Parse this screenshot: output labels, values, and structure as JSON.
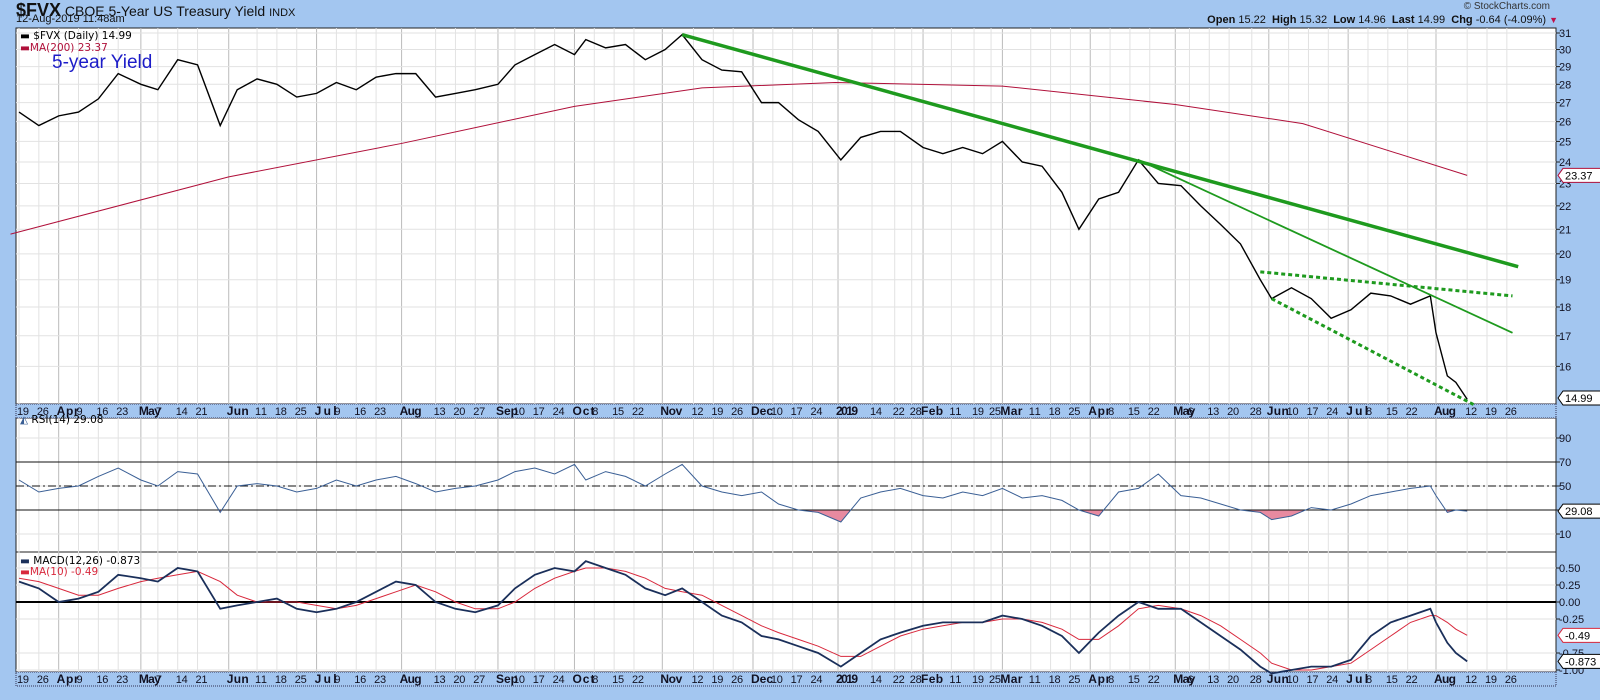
{
  "header": {
    "symbol": "$FVX",
    "name": "CBOE 5-Year US Treasury Yield",
    "exchange": "INDX",
    "timestamp": "12-Aug-2019 11:48am",
    "copyright": "© StockCharts.com",
    "open_label": "Open",
    "open": "15.22",
    "high_label": "High",
    "high": "15.32",
    "low_label": "Low",
    "low": "14.96",
    "last_label": "Last",
    "last": "14.99",
    "chg_label": "Chg",
    "chg": "-0.64 (-4.09%)",
    "chg_arrow": "▼"
  },
  "colors": {
    "price": "#000000",
    "ma200": "#b0103a",
    "trend": "#1e9a1e",
    "rsi": "#3a5f95",
    "rsi_over": "#6a9bd8",
    "rsi_under": "#e88aa0",
    "macd": "#1a2f5a",
    "signal": "#d8283c"
  },
  "chart_data": [
    {
      "type": "line",
      "title": "$FVX (Daily) 14.99",
      "ma_label": "MA(200) 23.37",
      "annotation": "5-year Yield",
      "scale": "log",
      "ylim": [
        15,
        31
      ],
      "yticks": [
        16,
        17,
        18,
        19,
        20,
        21,
        22,
        23,
        24,
        25,
        26,
        27,
        28,
        29,
        30,
        31
      ],
      "dates": [
        "2018-03-19",
        "2018-03-26",
        "2018-04-02",
        "2018-04-09",
        "2018-04-16",
        "2018-04-23",
        "2018-05-01",
        "2018-05-07",
        "2018-05-14",
        "2018-05-21",
        "2018-05-29",
        "2018-06-04",
        "2018-06-11",
        "2018-06-18",
        "2018-06-25",
        "2018-07-02",
        "2018-07-09",
        "2018-07-16",
        "2018-07-23",
        "2018-07-30",
        "2018-08-06",
        "2018-08-13",
        "2018-08-20",
        "2018-08-27",
        "2018-09-04",
        "2018-09-10",
        "2018-09-17",
        "2018-09-24",
        "2018-10-01",
        "2018-10-05",
        "2018-10-12",
        "2018-10-19",
        "2018-10-26",
        "2018-11-02",
        "2018-11-08",
        "2018-11-15",
        "2018-11-22",
        "2018-11-29",
        "2018-12-06",
        "2018-12-12",
        "2018-12-19",
        "2018-12-26",
        "2019-01-03",
        "2019-01-10",
        "2019-01-17",
        "2019-01-24",
        "2019-02-01",
        "2019-02-08",
        "2019-02-15",
        "2019-02-22",
        "2019-03-01",
        "2019-03-08",
        "2019-03-15",
        "2019-03-22",
        "2019-03-28",
        "2019-04-04",
        "2019-04-11",
        "2019-04-18",
        "2019-04-25",
        "2019-05-03",
        "2019-05-10",
        "2019-05-17",
        "2019-05-24",
        "2019-05-31",
        "2019-06-04",
        "2019-06-11",
        "2019-06-18",
        "2019-06-25",
        "2019-07-02",
        "2019-07-09",
        "2019-07-16",
        "2019-07-23",
        "2019-07-30",
        "2019-08-01",
        "2019-08-05",
        "2019-08-08",
        "2019-08-12"
      ],
      "values": [
        26.5,
        25.8,
        26.3,
        26.5,
        27.2,
        28.6,
        28.0,
        27.7,
        29.4,
        29.1,
        25.8,
        27.7,
        28.3,
        28.0,
        27.3,
        27.5,
        28.1,
        27.7,
        28.4,
        28.6,
        28.6,
        27.3,
        27.5,
        27.7,
        28.0,
        29.1,
        29.7,
        30.3,
        29.7,
        30.6,
        30.1,
        30.3,
        29.4,
        30.0,
        30.9,
        29.4,
        28.8,
        28.7,
        27.0,
        27.0,
        26.1,
        25.5,
        24.1,
        25.2,
        25.5,
        25.5,
        24.7,
        24.4,
        24.7,
        24.4,
        25.0,
        24.0,
        23.8,
        22.6,
        21.0,
        22.3,
        22.6,
        24.1,
        23.0,
        22.9,
        22.0,
        21.2,
        20.4,
        19.0,
        18.3,
        18.7,
        18.3,
        17.6,
        17.9,
        18.5,
        18.4,
        18.1,
        18.4,
        17.1,
        15.7,
        15.5,
        14.99
      ],
      "ma200": [
        [
          "2018-03-16",
          20.8
        ],
        [
          "2018-06-01",
          23.3
        ],
        [
          "2018-08-01",
          24.9
        ],
        [
          "2018-10-01",
          26.8
        ],
        [
          "2018-11-15",
          27.8
        ],
        [
          "2019-01-01",
          28.1
        ],
        [
          "2019-03-01",
          27.9
        ],
        [
          "2019-05-01",
          26.9
        ],
        [
          "2019-06-15",
          25.9
        ],
        [
          "2019-08-12",
          23.37
        ]
      ],
      "last_tag": "14.99",
      "ma_tag": "23.37",
      "trendlines": [
        {
          "style": "thick",
          "from": [
            "2018-11-08",
            30.9
          ],
          "to": [
            "2019-08-30",
            19.5
          ]
        },
        {
          "style": "thin",
          "from": [
            "2019-04-18",
            24.1
          ],
          "to": [
            "2019-08-28",
            17.1
          ]
        },
        {
          "style": "dotted",
          "from": [
            "2019-05-31",
            19.3
          ],
          "to": [
            "2019-08-28",
            18.4
          ]
        },
        {
          "style": "dotted",
          "from": [
            "2019-06-04",
            18.3
          ],
          "to": [
            "2019-08-15",
            14.8
          ]
        }
      ]
    },
    {
      "type": "line",
      "title": "RSI(14) 29.08",
      "ylim": [
        0,
        100
      ],
      "yticks": [
        10,
        30,
        50,
        70,
        90
      ],
      "levels": [
        70,
        50,
        30
      ],
      "last_tag": "29.08",
      "values": [
        55,
        45,
        48,
        50,
        58,
        65,
        55,
        50,
        62,
        60,
        28,
        50,
        52,
        50,
        45,
        48,
        55,
        50,
        55,
        58,
        52,
        45,
        48,
        50,
        55,
        62,
        65,
        60,
        68,
        55,
        62,
        58,
        50,
        60,
        68,
        50,
        45,
        42,
        45,
        35,
        30,
        28,
        20,
        40,
        45,
        48,
        42,
        40,
        45,
        42,
        48,
        40,
        42,
        38,
        30,
        25,
        45,
        48,
        60,
        42,
        40,
        35,
        30,
        28,
        22,
        25,
        32,
        30,
        35,
        42,
        45,
        48,
        50,
        42,
        28,
        30,
        29.08
      ]
    },
    {
      "type": "line",
      "title": "MACD(12,26) -0.873",
      "signal_title": "MA(10) -0.49",
      "yticks": [
        0.5,
        0.25,
        0.0,
        -0.25,
        -0.75,
        -1.0
      ],
      "ytick_labels": [
        "0.50",
        "0.25",
        "0.00",
        "-0.25",
        "-0.75",
        "-1.00"
      ],
      "macd_tag": "-0.873",
      "signal_tag": "-0.49",
      "macd": [
        0.3,
        0.2,
        0.0,
        0.05,
        0.15,
        0.4,
        0.35,
        0.3,
        0.5,
        0.45,
        -0.1,
        -0.05,
        0.0,
        0.05,
        -0.1,
        -0.15,
        -0.1,
        0.0,
        0.15,
        0.3,
        0.25,
        0.0,
        -0.1,
        -0.15,
        -0.05,
        0.2,
        0.4,
        0.5,
        0.45,
        0.6,
        0.5,
        0.4,
        0.2,
        0.1,
        0.2,
        0.0,
        -0.2,
        -0.3,
        -0.5,
        -0.55,
        -0.65,
        -0.75,
        -0.95,
        -0.75,
        -0.55,
        -0.45,
        -0.35,
        -0.3,
        -0.3,
        -0.3,
        -0.2,
        -0.25,
        -0.35,
        -0.5,
        -0.75,
        -0.45,
        -0.2,
        0.0,
        -0.1,
        -0.1,
        -0.3,
        -0.5,
        -0.7,
        -0.95,
        -1.05,
        -1.0,
        -0.95,
        -0.95,
        -0.85,
        -0.5,
        -0.3,
        -0.2,
        -0.1,
        -0.3,
        -0.6,
        -0.75,
        -0.873
      ],
      "signal": [
        0.35,
        0.3,
        0.2,
        0.1,
        0.1,
        0.2,
        0.3,
        0.35,
        0.4,
        0.45,
        0.3,
        0.1,
        0.0,
        0.0,
        0.0,
        -0.05,
        -0.1,
        -0.05,
        0.05,
        0.15,
        0.25,
        0.15,
        0.0,
        -0.1,
        -0.1,
        0.0,
        0.2,
        0.35,
        0.45,
        0.5,
        0.5,
        0.45,
        0.35,
        0.2,
        0.15,
        0.1,
        -0.05,
        -0.2,
        -0.35,
        -0.45,
        -0.55,
        -0.65,
        -0.8,
        -0.8,
        -0.65,
        -0.5,
        -0.4,
        -0.35,
        -0.3,
        -0.3,
        -0.25,
        -0.25,
        -0.3,
        -0.4,
        -0.55,
        -0.55,
        -0.35,
        -0.1,
        -0.05,
        -0.1,
        -0.2,
        -0.35,
        -0.55,
        -0.75,
        -0.9,
        -1.0,
        -1.0,
        -0.95,
        -0.9,
        -0.7,
        -0.5,
        -0.3,
        -0.2,
        -0.2,
        -0.3,
        -0.4,
        -0.49
      ]
    }
  ],
  "xaxis": [
    [
      "19",
      "2018-03-19",
      0
    ],
    [
      "26",
      "2018-03-26",
      0
    ],
    [
      "Apr",
      "2018-04-02",
      1
    ],
    [
      "9",
      "2018-04-09",
      0
    ],
    [
      "16",
      "2018-04-16",
      0
    ],
    [
      "23",
      "2018-04-23",
      0
    ],
    [
      "May",
      "2018-05-01",
      1
    ],
    [
      "7",
      "2018-05-07",
      0
    ],
    [
      "14",
      "2018-05-14",
      0
    ],
    [
      "21",
      "2018-05-21",
      0
    ],
    [
      "Jun",
      "2018-06-01",
      1
    ],
    [
      "11",
      "2018-06-11",
      0
    ],
    [
      "18",
      "2018-06-18",
      0
    ],
    [
      "25",
      "2018-06-25",
      0
    ],
    [
      "Jul",
      "2018-07-02",
      1
    ],
    [
      "9",
      "2018-07-09",
      0
    ],
    [
      "16",
      "2018-07-16",
      0
    ],
    [
      "23",
      "2018-07-23",
      0
    ],
    [
      "Aug",
      "2018-08-01",
      1
    ],
    [
      "13",
      "2018-08-13",
      0
    ],
    [
      "20",
      "2018-08-20",
      0
    ],
    [
      "27",
      "2018-08-27",
      0
    ],
    [
      "Sep",
      "2018-09-04",
      1
    ],
    [
      "10",
      "2018-09-10",
      0
    ],
    [
      "17",
      "2018-09-17",
      0
    ],
    [
      "24",
      "2018-09-24",
      0
    ],
    [
      "Oct",
      "2018-10-01",
      1
    ],
    [
      "8",
      "2018-10-08",
      0
    ],
    [
      "15",
      "2018-10-15",
      0
    ],
    [
      "22",
      "2018-10-22",
      0
    ],
    [
      "Nov",
      "2018-11-01",
      1
    ],
    [
      "12",
      "2018-11-12",
      0
    ],
    [
      "19",
      "2018-11-19",
      0
    ],
    [
      "26",
      "2018-11-26",
      0
    ],
    [
      "Dec",
      "2018-12-03",
      1
    ],
    [
      "10",
      "2018-12-10",
      0
    ],
    [
      "17",
      "2018-12-17",
      0
    ],
    [
      "24",
      "2018-12-24",
      0
    ],
    [
      "2019",
      "2019-01-02",
      1
    ],
    [
      "14",
      "2019-01-14",
      0
    ],
    [
      "22",
      "2019-01-22",
      0
    ],
    [
      "28",
      "2019-01-28",
      0
    ],
    [
      "Feb",
      "2019-02-01",
      1
    ],
    [
      "11",
      "2019-02-11",
      0
    ],
    [
      "19",
      "2019-02-19",
      0
    ],
    [
      "25",
      "2019-02-25",
      0
    ],
    [
      "Mar",
      "2019-03-01",
      1
    ],
    [
      "11",
      "2019-03-11",
      0
    ],
    [
      "18",
      "2019-03-18",
      0
    ],
    [
      "25",
      "2019-03-25",
      0
    ],
    [
      "Apr",
      "2019-04-01",
      1
    ],
    [
      "8",
      "2019-04-08",
      0
    ],
    [
      "15",
      "2019-04-15",
      0
    ],
    [
      "22",
      "2019-04-22",
      0
    ],
    [
      "May",
      "2019-05-01",
      1
    ],
    [
      "6",
      "2019-05-06",
      0
    ],
    [
      "13",
      "2019-05-13",
      0
    ],
    [
      "20",
      "2019-05-20",
      0
    ],
    [
      "28",
      "2019-05-28",
      0
    ],
    [
      "Jun",
      "2019-06-03",
      1
    ],
    [
      "10",
      "2019-06-10",
      0
    ],
    [
      "17",
      "2019-06-17",
      0
    ],
    [
      "24",
      "2019-06-24",
      0
    ],
    [
      "Jul",
      "2019-07-01",
      1
    ],
    [
      "8",
      "2019-07-08",
      0
    ],
    [
      "15",
      "2019-07-15",
      0
    ],
    [
      "22",
      "2019-07-22",
      0
    ],
    [
      "Aug",
      "2019-08-01",
      1
    ],
    [
      "12",
      "2019-08-12",
      0
    ],
    [
      "19",
      "2019-08-19",
      0
    ],
    [
      "26",
      "2019-08-26",
      0
    ]
  ]
}
